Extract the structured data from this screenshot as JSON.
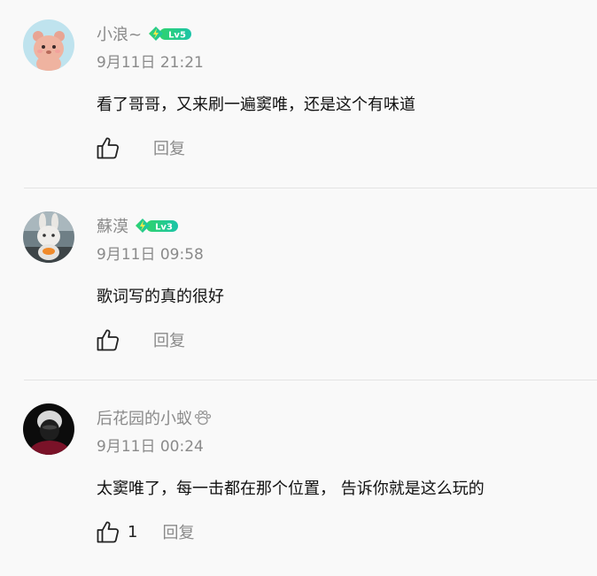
{
  "colors": {
    "meta_text": "#8a8a8a",
    "content_text": "#111111",
    "badge_gradient_start": "#2fd36d",
    "badge_gradient_end": "#1cc4a8",
    "divider": "#e3e3e3"
  },
  "comments": [
    {
      "username": "小浪~",
      "level": "Lv5",
      "timestamp": "9月11日 21:21",
      "content": "看了哥哥，又来刷一遍窦唯，还是这个有味道",
      "likes": "",
      "reply_label": "回复",
      "avatar_icon": "cartoon-bear-avatar"
    },
    {
      "username": "蘇漠",
      "level": "Lv3",
      "timestamp": "9月11日 09:58",
      "content": "歌词写的真的很好",
      "likes": "",
      "reply_label": "回复",
      "avatar_icon": "plush-bunny-avatar"
    },
    {
      "username": "后花园的小蚁",
      "level": "",
      "timestamp": "9月11日 00:24",
      "content": "太窦唯了，每一击都在那个位置， 告诉你就是这么玩的",
      "likes": "1",
      "reply_label": "回复",
      "avatar_icon": "masked-figure-avatar",
      "badge_icon": "paw-icon"
    }
  ]
}
